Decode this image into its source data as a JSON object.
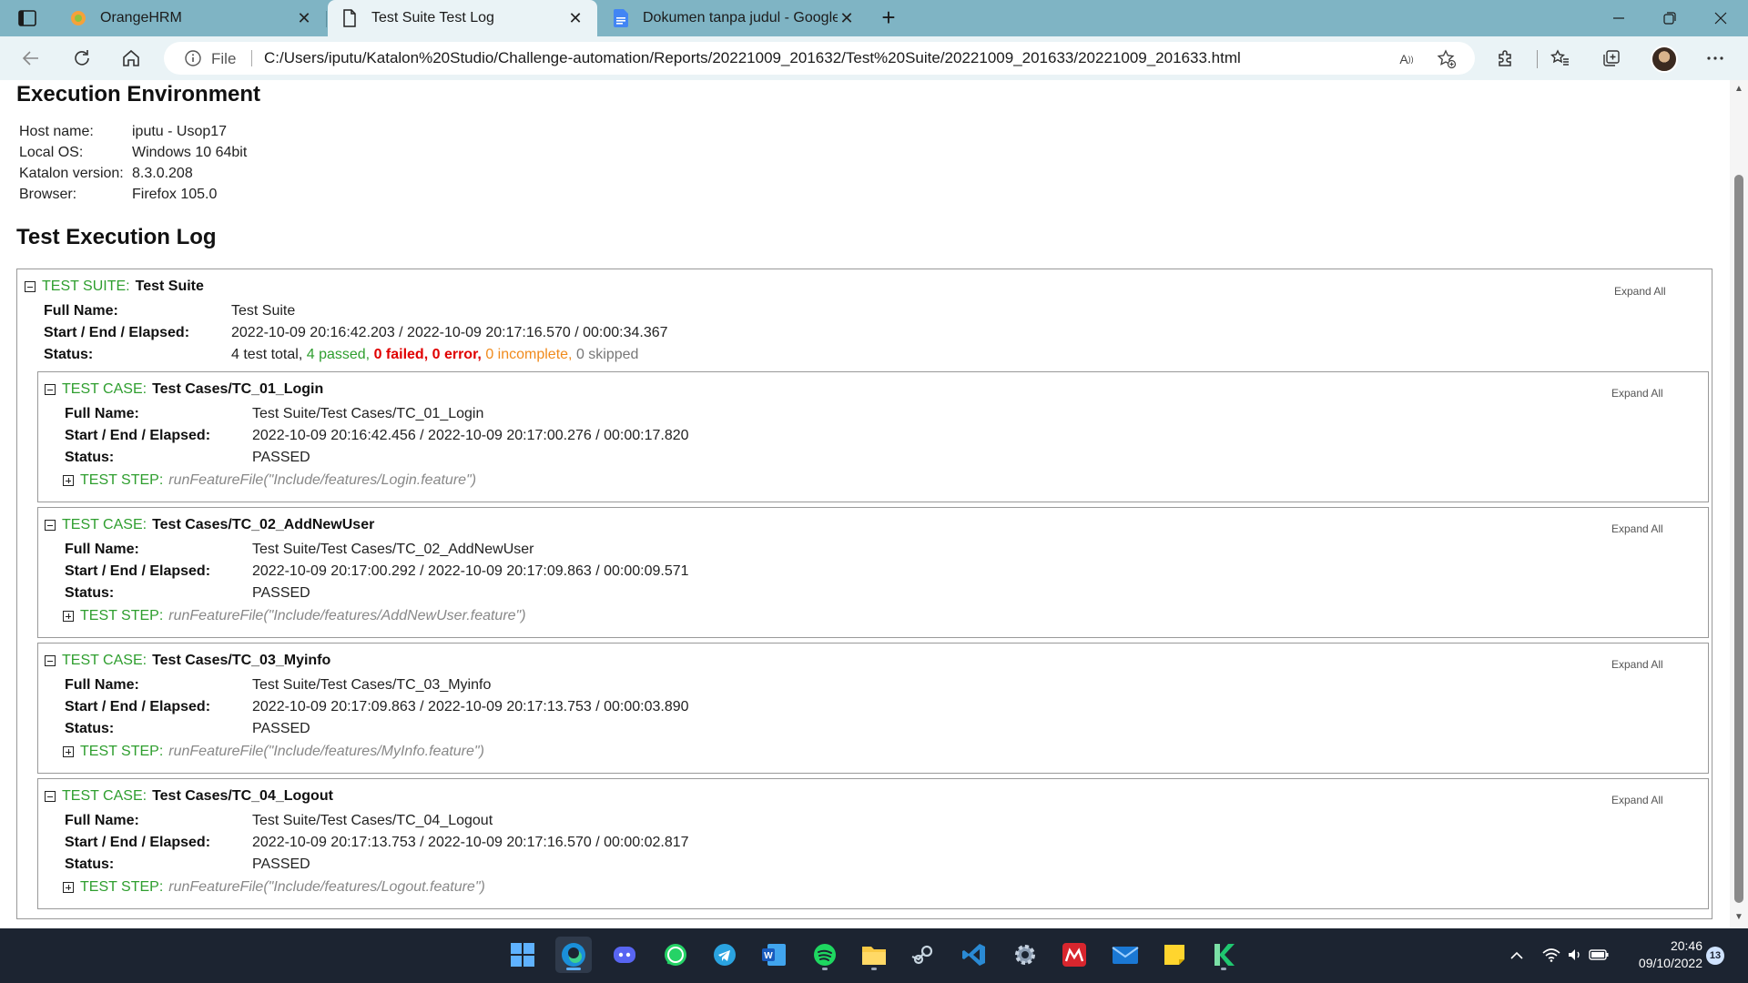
{
  "browser": {
    "tabs": [
      {
        "title": "OrangeHRM",
        "icon": "orangehrm-favicon"
      },
      {
        "title": "Test Suite Test Log",
        "icon": "document-icon"
      },
      {
        "title": "Dokumen tanpa judul - Google D",
        "icon": "google-docs-icon"
      }
    ],
    "address": {
      "scheme_label": "File",
      "url": "C:/Users/iputu/Katalon%20Studio/Challenge-automation/Reports/20221009_201632/Test%20Suite/20221009_201633/20221009_201633.html"
    }
  },
  "page": {
    "env_title": "Execution Environment",
    "env": [
      {
        "k": "Host name:",
        "v": "iputu - Usop17"
      },
      {
        "k": "Local OS:",
        "v": "Windows 10 64bit"
      },
      {
        "k": "Katalon version:",
        "v": "8.3.0.208"
      },
      {
        "k": "Browser:",
        "v": "Firefox 105.0"
      }
    ],
    "log_title": "Test Execution Log",
    "expand_all": "Expand All",
    "suite": {
      "label": "TEST SUITE:",
      "name": "Test Suite",
      "full_name_k": "Full Name:",
      "full_name_v": "Test Suite",
      "time_k": "Start / End / Elapsed:",
      "time_v": "2022-10-09 20:16:42.203 / 2022-10-09 20:17:16.570 / 00:00:34.367",
      "status_k": "Status:",
      "status": {
        "total": "4 test total,",
        "passed": "4 passed,",
        "failed": "0 failed,",
        "error": "0 error,",
        "incomplete": "0 incomplete,",
        "skipped": "0 skipped"
      }
    },
    "case_label": "TEST CASE:",
    "step_label": "TEST STEP:",
    "full_name_k": "Full Name:",
    "time_k": "Start / End / Elapsed:",
    "status_k": "Status:",
    "cases": [
      {
        "name": "Test Cases/TC_01_Login",
        "full_name": "Test Suite/Test Cases/TC_01_Login",
        "time": "2022-10-09 20:16:42.456 / 2022-10-09 20:17:00.276 / 00:00:17.820",
        "status": "PASSED",
        "step": "runFeatureFile(\"Include/features/Login.feature\")"
      },
      {
        "name": "Test Cases/TC_02_AddNewUser",
        "full_name": "Test Suite/Test Cases/TC_02_AddNewUser",
        "time": "2022-10-09 20:17:00.292 / 2022-10-09 20:17:09.863 / 00:00:09.571",
        "status": "PASSED",
        "step": "runFeatureFile(\"Include/features/AddNewUser.feature\")"
      },
      {
        "name": "Test Cases/TC_03_Myinfo",
        "full_name": "Test Suite/Test Cases/TC_03_Myinfo",
        "time": "2022-10-09 20:17:09.863 / 2022-10-09 20:17:13.753 / 00:00:03.890",
        "status": "PASSED",
        "step": "runFeatureFile(\"Include/features/MyInfo.feature\")"
      },
      {
        "name": "Test Cases/TC_04_Logout",
        "full_name": "Test Suite/Test Cases/TC_04_Logout",
        "time": "2022-10-09 20:17:13.753 / 2022-10-09 20:17:16.570 / 00:00:02.817",
        "status": "PASSED",
        "step": "runFeatureFile(\"Include/features/Logout.feature\")"
      }
    ]
  },
  "taskbar": {
    "apps": [
      "start-icon",
      "edge-icon",
      "discord-icon",
      "whatsapp-icon",
      "telegram-icon",
      "word-icon",
      "spotify-icon",
      "file-explorer-icon",
      "steam-icon",
      "vscode-icon",
      "settings-icon",
      "mendeley-icon",
      "mail-icon",
      "sticky-notes-icon",
      "katalon-icon"
    ],
    "time": "20:46",
    "date": "09/10/2022",
    "notifications": "13"
  }
}
